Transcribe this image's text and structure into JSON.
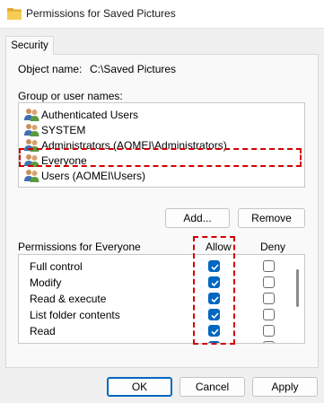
{
  "window": {
    "title": "Permissions for Saved Pictures"
  },
  "tabs": [
    {
      "label": "Security"
    }
  ],
  "object": {
    "label": "Object name:",
    "value": "C:\\Saved Pictures"
  },
  "groups": {
    "label": "Group or user names:",
    "items": [
      {
        "label": "Authenticated Users"
      },
      {
        "label": "SYSTEM"
      },
      {
        "label": "Administrators (AOMEI\\Administrators)"
      },
      {
        "label": "Everyone",
        "selected": true
      },
      {
        "label": "Users (AOMEI\\Users)"
      }
    ]
  },
  "buttons": {
    "add": "Add...",
    "remove": "Remove",
    "ok": "OK",
    "cancel": "Cancel",
    "apply": "Apply"
  },
  "permissions": {
    "label": "Permissions for Everyone",
    "allow_header": "Allow",
    "deny_header": "Deny",
    "rows": [
      {
        "name": "Full control",
        "allow": true,
        "deny": false
      },
      {
        "name": "Modify",
        "allow": true,
        "deny": false
      },
      {
        "name": "Read & execute",
        "allow": true,
        "deny": false
      },
      {
        "name": "List folder contents",
        "allow": true,
        "deny": false
      },
      {
        "name": "Read",
        "allow": true,
        "deny": false
      }
    ]
  },
  "colors": {
    "accent": "#0067c0",
    "annotation": "#d40000",
    "folder": "#f2c94c"
  },
  "icons": {
    "title": "folder-icon",
    "user": "users-icon"
  }
}
